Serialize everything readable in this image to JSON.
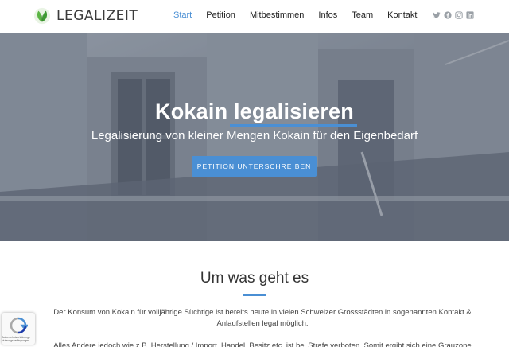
{
  "brand": {
    "name": "LEGALIZEIT"
  },
  "nav": {
    "items": [
      {
        "label": "Start",
        "active": true
      },
      {
        "label": "Petition",
        "active": false
      },
      {
        "label": "Mitbestimmen",
        "active": false
      },
      {
        "label": "Infos",
        "active": false
      },
      {
        "label": "Team",
        "active": false
      },
      {
        "label": "Kontakt",
        "active": false
      }
    ]
  },
  "social": [
    "twitter-icon",
    "facebook-icon",
    "instagram-icon",
    "linkedin-icon"
  ],
  "hero": {
    "title": "Kokain legalisieren",
    "subtitle": "Legalisierung von kleiner Mengen Kokain für den Eigenbedarf",
    "button": "PETITION UNTERSCHREIBEN"
  },
  "section": {
    "title": "Um was geht es",
    "paragraph1": "Der Konsum von Kokain für volljährige Süchtige ist bereits heute in vielen Schweizer Grossstädten in sogenannten Kontakt & Anlaufstellen legal möglich.",
    "paragraph2": "Alles Andere jedoch wie z.B. Herstellung / Import, Handel, Besitz etc. ist bei Strafe verboten. Somit ergibt sich eine Grauzone"
  },
  "recaptcha": {
    "privacy": "Datenschutzerklärung - Nutzungsbedingungen"
  },
  "colors": {
    "accent": "#4a8fd4",
    "nav_active": "#4a8fd4",
    "logo_green": "#5bb544"
  }
}
